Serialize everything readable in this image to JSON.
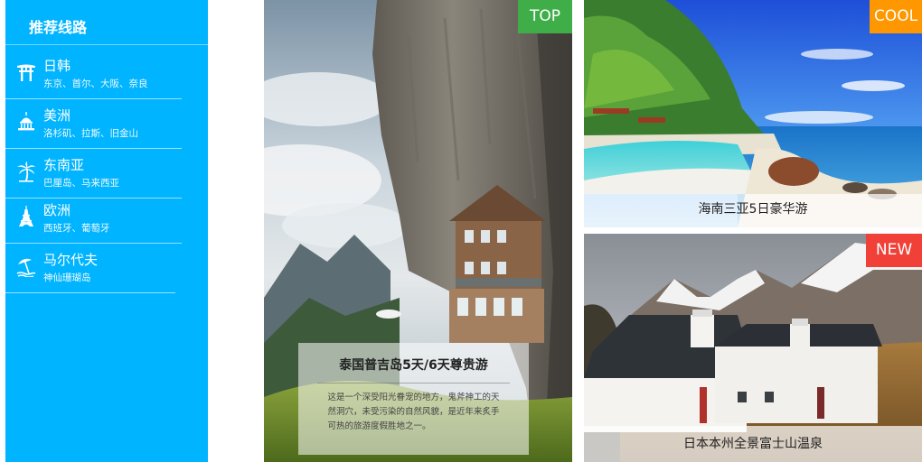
{
  "sidebar": {
    "title": "推荐线路",
    "routes": [
      {
        "name": "日韩",
        "cities": "东京、首尔、大阪、奈良",
        "icon": "torii-gate-icon"
      },
      {
        "name": "美洲",
        "cities": "洛杉矶、拉斯、旧金山",
        "icon": "capitol-dome-icon"
      },
      {
        "name": "东南亚",
        "cities": "巴厘岛、马来西亚",
        "icon": "palm-tree-icon"
      },
      {
        "name": "欧洲",
        "cities": "西班牙、葡萄牙",
        "icon": "eiffel-tower-icon"
      },
      {
        "name": "马尔代夫",
        "cities": "神仙珊瑚岛",
        "icon": "beach-umbrella-icon"
      }
    ]
  },
  "cards": {
    "featured": {
      "badge": "TOP",
      "title": "泰国普吉岛5天/6天尊贵游",
      "description": "这是一个深受阳光眷宠的地方，鬼斧神工的天然洞穴，未受污染的自然风貌，是近年来炙手可热的旅游度假胜地之一。"
    },
    "hainan": {
      "badge": "COOL",
      "caption": "海南三亚5日豪华游"
    },
    "japan": {
      "badge": "NEW",
      "caption": "日本本州全景富士山温泉"
    }
  },
  "colors": {
    "sidebar": "#00b4ff",
    "badge_top": "#3fae49",
    "badge_cool": "#ff9800",
    "badge_new": "#f04038"
  }
}
